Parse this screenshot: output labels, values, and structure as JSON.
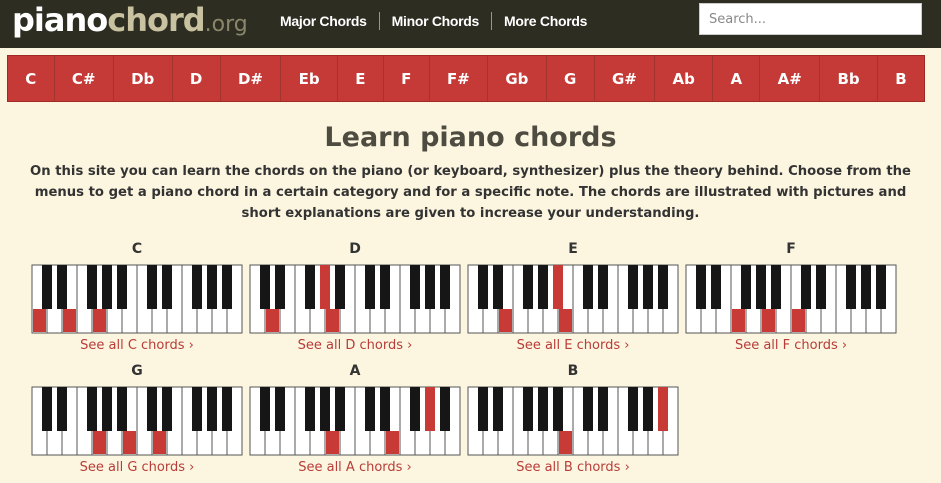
{
  "header": {
    "logo": {
      "part1": "piano",
      "part2": "chord",
      "part3": ".org"
    },
    "nav": [
      {
        "label": "Major Chords"
      },
      {
        "label": "Minor Chords"
      },
      {
        "label": "More Chords"
      }
    ],
    "search": {
      "placeholder": "Search...",
      "value": ""
    }
  },
  "notes": [
    "C",
    "C#",
    "Db",
    "D",
    "D#",
    "Eb",
    "E",
    "F",
    "F#",
    "Gb",
    "G",
    "G#",
    "Ab",
    "A",
    "A#",
    "Bb",
    "B"
  ],
  "main": {
    "title": "Learn piano chords",
    "intro": "On this site you can learn the chords on the piano (or keyboard, synthesizer) plus the theory behind. Choose from the menus to get a piano chord in a certain category and for a specific note. The chords are illustrated with pictures and short explanations are given to increase your understanding."
  },
  "chords": [
    {
      "name": "C",
      "link": "See all C chords ›",
      "white": [
        0,
        2,
        4
      ],
      "black": []
    },
    {
      "name": "D",
      "link": "See all D chords ›",
      "white": [
        1,
        5
      ],
      "black": [
        3
      ]
    },
    {
      "name": "E",
      "link": "See all E chords ›",
      "white": [
        2,
        6
      ],
      "black": [
        4
      ]
    },
    {
      "name": "F",
      "link": "See all F chords ›",
      "white": [
        3,
        5,
        7
      ],
      "black": []
    },
    {
      "name": "G",
      "link": "See all G chords ›",
      "white": [
        4,
        6,
        8
      ],
      "black": []
    },
    {
      "name": "A",
      "link": "See all A chords ›",
      "white": [
        5,
        9
      ],
      "black": [
        8
      ]
    },
    {
      "name": "B",
      "link": "See all B chords ›",
      "white": [
        6
      ],
      "black": [
        9,
        10
      ]
    }
  ],
  "colors": {
    "accent": "#c53a36",
    "header_bg": "#2d2d22",
    "page_bg": "#fcf6e0",
    "highlight": "#c73a36",
    "white_key": "#ffffff",
    "black_key": "#161616"
  }
}
